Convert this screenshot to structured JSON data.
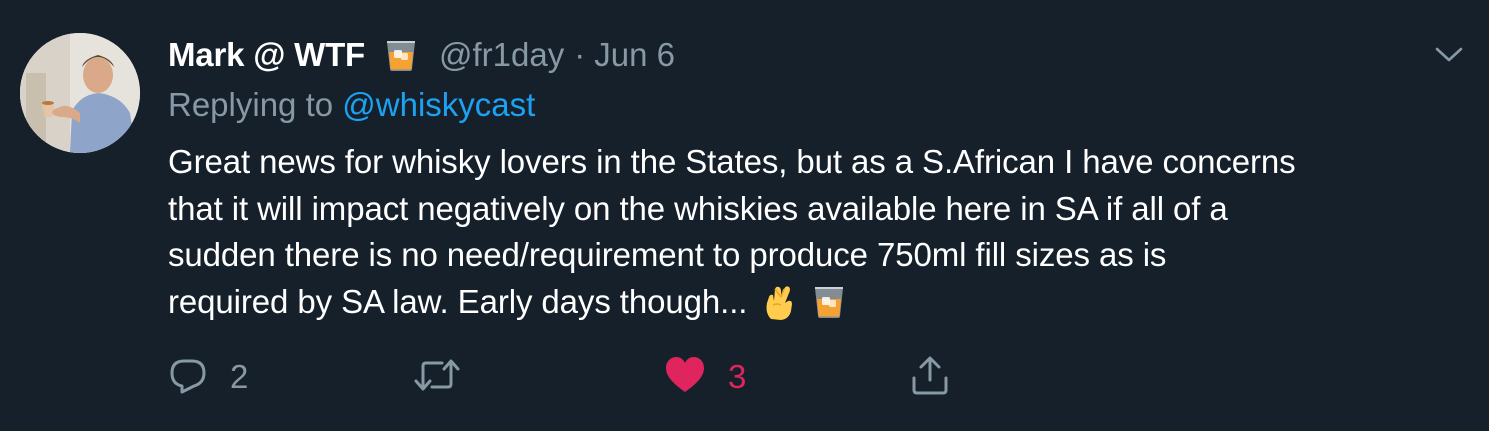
{
  "tweet": {
    "display_name": "Mark @ WTF",
    "name_emoji": "tumbler-glass-emoji",
    "handle": "@fr1day",
    "separator": "·",
    "date": "Jun 6",
    "replying_prefix": "Replying to",
    "replying_to": "@whiskycast",
    "body_lines": [
      "Great news for whisky lovers in the States, but as a S.African I have concerns",
      "that it will impact negatively on the whiskies available here in SA if all of a",
      "sudden there is no need/requirement to produce 750ml fill sizes as is",
      "required by SA law. Early days though..."
    ],
    "body_emojis": [
      "crossed-fingers-emoji",
      "tumbler-glass-emoji"
    ],
    "actions": {
      "reply_count": "2",
      "retweet_count": "",
      "like_count": "3",
      "liked": true
    }
  },
  "colors": {
    "background": "#15202b",
    "text_primary": "#ffffff",
    "text_secondary": "#8899a6",
    "link": "#1da1f2",
    "like": "#e0245e"
  }
}
